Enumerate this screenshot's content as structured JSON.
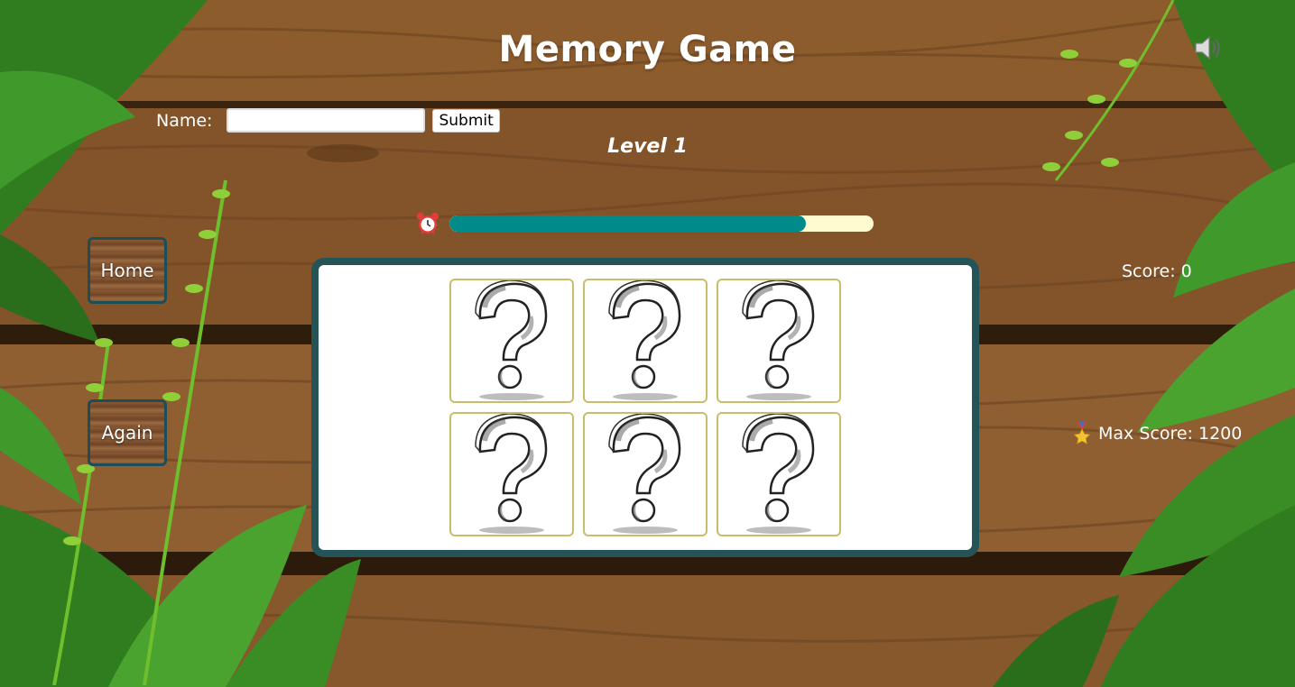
{
  "header": {
    "title": "Memory Game"
  },
  "form": {
    "name_label": "Name:",
    "name_value": "",
    "submit_label": "Submit"
  },
  "game": {
    "level_text": "Level 1",
    "timer_progress": 0.84,
    "score_text": "Score: 0",
    "max_score_text": "Max Score: 1200"
  },
  "nav": {
    "home_label": "Home",
    "again_label": "Again"
  },
  "board": {
    "cards": [
      {
        "state": "hidden",
        "icon": "question-mark-icon"
      },
      {
        "state": "hidden",
        "icon": "question-mark-icon"
      },
      {
        "state": "hidden",
        "icon": "question-mark-icon"
      },
      {
        "state": "hidden",
        "icon": "question-mark-icon"
      },
      {
        "state": "hidden",
        "icon": "question-mark-icon"
      },
      {
        "state": "hidden",
        "icon": "question-mark-icon"
      }
    ]
  },
  "icons": {
    "sound": "speaker-icon",
    "timer": "alarm-clock-icon",
    "medal": "medal-icon"
  },
  "colors": {
    "timer_fill": "#008b8b",
    "timer_track": "#fffbd0",
    "board_border": "#245457",
    "card_border": "#c8bd6a"
  }
}
